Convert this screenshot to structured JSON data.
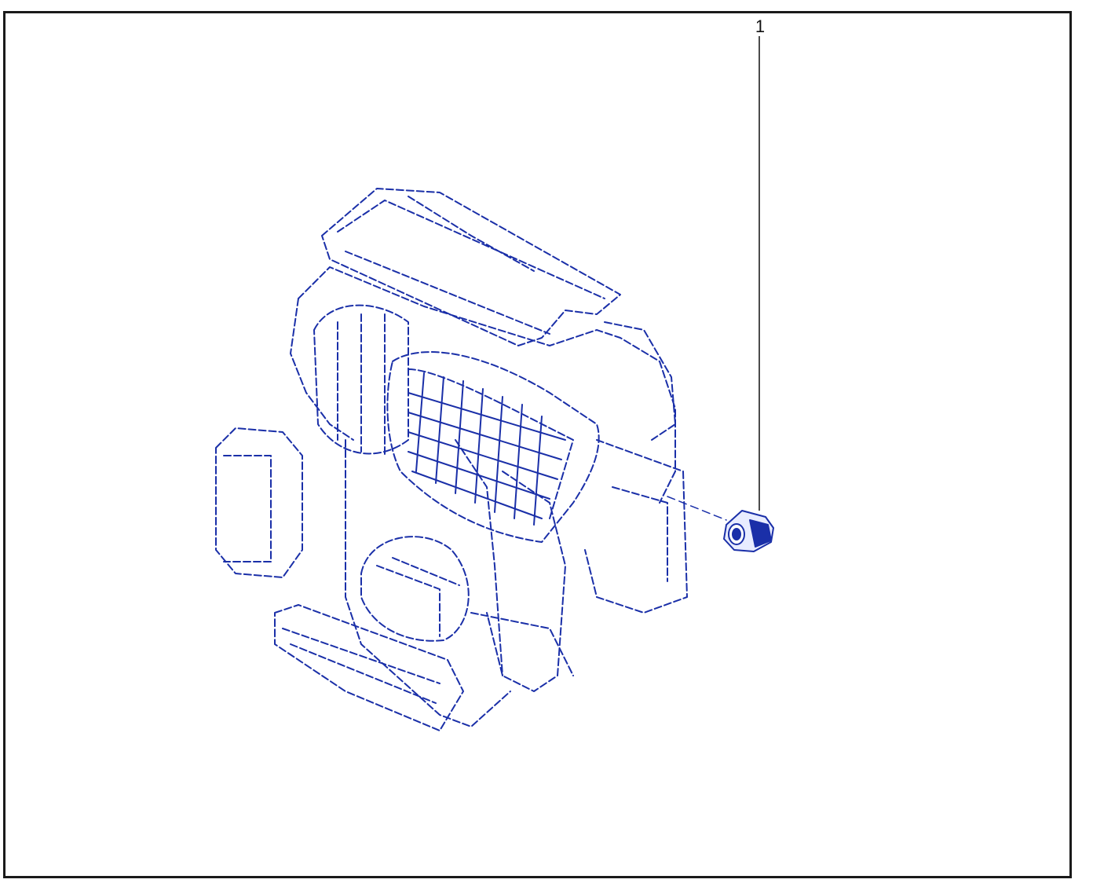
{
  "diagram": {
    "callouts": [
      {
        "label": "1"
      }
    ],
    "colors": {
      "line_art": "#1a2fa8",
      "frame": "#1a1a1a",
      "leader": "#111111",
      "background": "#ffffff"
    },
    "icons": {
      "assembly": "hvac-unit-assembly-icon",
      "part": "sensor-part-icon"
    }
  }
}
